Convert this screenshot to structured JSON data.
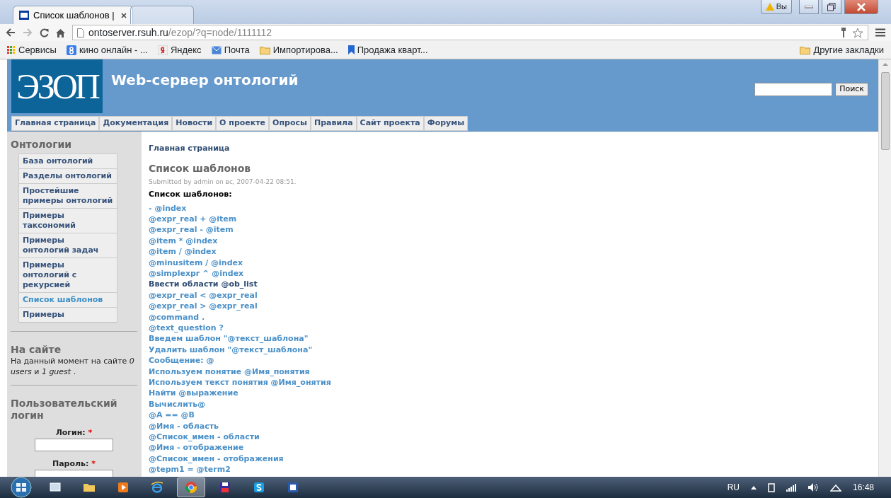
{
  "browser": {
    "tabs": [
      {
        "title": "Список шаблонов |",
        "selected": true
      },
      {
        "selected": false
      }
    ],
    "profile_button": "Вы",
    "url": {
      "host": "ontoserver.rsuh.ru",
      "path": "/ezop/?q=node/1111112"
    },
    "bookmarks": [
      {
        "label": "Сервисы",
        "kind": "apps"
      },
      {
        "label": "кино онлайн - ...",
        "kind": "google"
      },
      {
        "label": "Яндекс",
        "kind": "yandex"
      },
      {
        "label": "Почта",
        "kind": "mail"
      },
      {
        "label": "Импортирова...",
        "kind": "folder"
      },
      {
        "label": "Продажа кварт...",
        "kind": "bookmark"
      }
    ],
    "other_bookmarks": "Другие закладки"
  },
  "site": {
    "logo": "ЭЗОП",
    "title": "Web-сервер онтологий",
    "search_button": "Поиск",
    "nav": [
      "Главная страница",
      "Документация",
      "Новости",
      "О проекте",
      "Опросы",
      "Правила",
      "Сайт проекта",
      "Форумы"
    ]
  },
  "sidebar": {
    "ontologies": {
      "title": "Онтологии",
      "items": [
        {
          "label": "База онтологий",
          "selected": false
        },
        {
          "label": "Разделы онтологий",
          "selected": false
        },
        {
          "label": "Простейшие примеры онтологий",
          "selected": false
        },
        {
          "label": "Примеры таксономий",
          "selected": false
        },
        {
          "label": "Примеры онтологий задач",
          "selected": false
        },
        {
          "label": "Примеры онтологий с рекурсией",
          "selected": false
        },
        {
          "label": "Список шаблонов",
          "selected": true
        },
        {
          "label": "Примеры",
          "selected": false
        }
      ]
    },
    "online": {
      "title": "На сайте",
      "text": "На данный момент на сайте *0 users* и *1 guest* ."
    },
    "login": {
      "title": "Пользовательский логин",
      "required_mark": "*",
      "fields": [
        {
          "label": "Логин:",
          "required": true
        },
        {
          "label": "Пароль:",
          "required": true
        }
      ]
    }
  },
  "content": {
    "breadcrumb": "Главная страница",
    "title": "Список шаблонов",
    "submitted": "Submitted by admin on вс, 2007-04-22 08:51.",
    "heading": "Список шаблонов:",
    "templates": [
      {
        "text": "- @index",
        "visited": false
      },
      {
        "text": "@expr_real + @item",
        "visited": false
      },
      {
        "text": "@expr_real - @item",
        "visited": false
      },
      {
        "text": "@item * @index",
        "visited": false
      },
      {
        "text": "@item / @index",
        "visited": false
      },
      {
        "text": "@minusitem / @index",
        "visited": false
      },
      {
        "text": "@simplexpr ^ @index",
        "visited": false
      },
      {
        "text": "Ввести области @ob_list",
        "visited": true
      },
      {
        "text": "@expr_real < @expr_real",
        "visited": false
      },
      {
        "text": "@expr_real > @expr_real",
        "visited": false
      },
      {
        "text": "@command .",
        "visited": false
      },
      {
        "text": "@text_question ?",
        "visited": false
      },
      {
        "text": "Введем шаблон \"@текст_шаблона\"",
        "visited": false
      },
      {
        "text": "Удалить шаблон \"@текст_шаблона\"",
        "visited": false
      },
      {
        "text": "Сообщение: @",
        "visited": false
      },
      {
        "text": "Используем понятие @Имя_понятия",
        "visited": false
      },
      {
        "text": "Используем текст понятия @Имя_онятия",
        "visited": false
      },
      {
        "text": "Найти @выражение",
        "visited": false
      },
      {
        "text": "Вычислить@",
        "visited": false
      },
      {
        "text": "@A == @B",
        "visited": false
      },
      {
        "text": "@Имя - область",
        "visited": false
      },
      {
        "text": "@Список_имен - области",
        "visited": false
      },
      {
        "text": "@Имя - отображение",
        "visited": false
      },
      {
        "text": "@Список_имен - отображения",
        "visited": false
      },
      {
        "text": "@tepm1 = @term2",
        "visited": false
      }
    ]
  },
  "taskbar": {
    "apps": [
      {
        "kind": "desktop",
        "selected": false
      },
      {
        "kind": "explorer",
        "selected": false
      },
      {
        "kind": "media",
        "selected": false
      },
      {
        "kind": "ie",
        "selected": false
      },
      {
        "kind": "chrome",
        "selected": true
      },
      {
        "kind": "save",
        "selected": false
      },
      {
        "kind": "skype",
        "selected": false
      },
      {
        "kind": "word",
        "selected": false
      }
    ],
    "language": "RU",
    "time": "16:48"
  }
}
